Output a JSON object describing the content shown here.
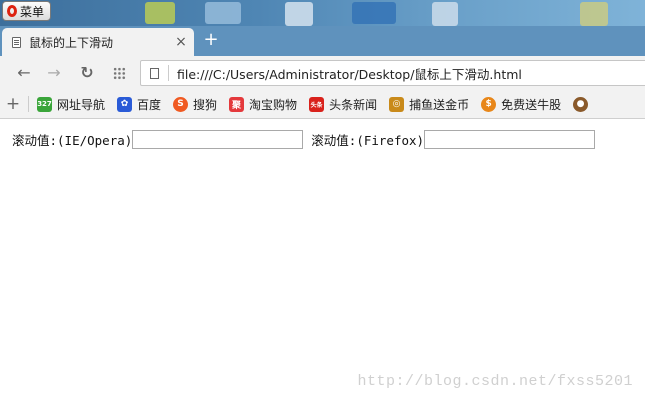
{
  "taskbar": {
    "menu_label": "菜单"
  },
  "tab": {
    "title": "鼠标的上下滑动",
    "close": "×",
    "new_tab": "+"
  },
  "toolbar": {
    "back": "←",
    "forward": "→",
    "reload": "↻",
    "url": "file:///C:/Users/Administrator/Desktop/鼠标上下滑动.html"
  },
  "bookmarks": {
    "add": "+",
    "items": [
      {
        "label": "网址导航",
        "icon": "url-nav-icon",
        "icon_text": "327",
        "color": "#3aa53a"
      },
      {
        "label": "百度",
        "icon": "baidu-paw-icon",
        "icon_text": "🐾",
        "color": "#2a5bd7"
      },
      {
        "label": "搜狗",
        "icon": "sogou-icon",
        "icon_text": "S",
        "color": "#f05a22"
      },
      {
        "label": "淘宝购物",
        "icon": "taobao-icon",
        "icon_text": "聚",
        "color": "#e4393c"
      },
      {
        "label": "头条新闻",
        "icon": "toutiao-icon",
        "icon_text": "头条",
        "color": "#d9221c"
      },
      {
        "label": "捕鱼送金币",
        "icon": "fish-game-icon",
        "icon_text": "◎",
        "color": "#c98a1a"
      },
      {
        "label": "免费送牛股",
        "icon": "stock-icon",
        "icon_text": "$",
        "color": "#e8871a"
      }
    ]
  },
  "page": {
    "label_ie": "滚动值:(IE/Opera)",
    "label_ff": "滚动值:(Firefox)",
    "input_ie_value": "",
    "input_ff_value": ""
  },
  "watermark": "http://blog.csdn.net/fxss5201"
}
